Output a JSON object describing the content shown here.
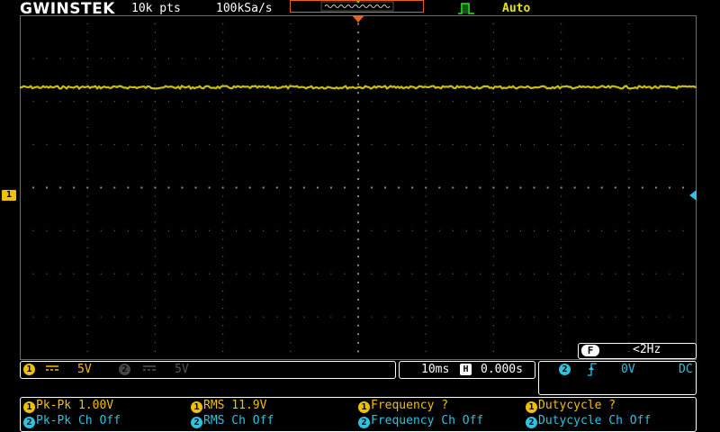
{
  "header": {
    "brand": "GWINSTEK",
    "record_length": "10k pts",
    "sample_rate": "100kSa/s",
    "trigger_status": "Auto"
  },
  "channel_marker": "1",
  "freq_counter": {
    "badge": "F",
    "value": "<2Hz"
  },
  "channels": {
    "ch1": {
      "badge": "1",
      "scale": "5V",
      "coupling_icon": "dc-coupling-icon"
    },
    "ch2": {
      "badge": "2",
      "scale": "5V",
      "coupling_icon": "dc-coupling-icon"
    }
  },
  "timebase": {
    "scale": "10ms",
    "badge": "H",
    "position": "0.000s"
  },
  "trigger": {
    "badge": "2",
    "slope_icon": "rising-edge-icon",
    "level": "0V",
    "coupling": "DC"
  },
  "measurements": [
    {
      "badge": "1",
      "text": "Pk-Pk 1.00V"
    },
    {
      "badge": "1",
      "text": "RMS 11.9V"
    },
    {
      "badge": "1",
      "text": "Frequency ?"
    },
    {
      "badge": "1",
      "text": "Dutycycle ?"
    },
    {
      "badge": "2",
      "text": "Pk-Pk Ch Off"
    },
    {
      "badge": "2",
      "text": "RMS Ch Off"
    },
    {
      "badge": "2",
      "text": "Frequency Ch Off"
    },
    {
      "badge": "2",
      "text": "Dutycycle Ch Off"
    }
  ],
  "colors": {
    "ch1": "#f0c000",
    "ch2": "#30c0e0",
    "trigger_pos": "#e8641c",
    "trigger_ok": "#33dd33"
  }
}
